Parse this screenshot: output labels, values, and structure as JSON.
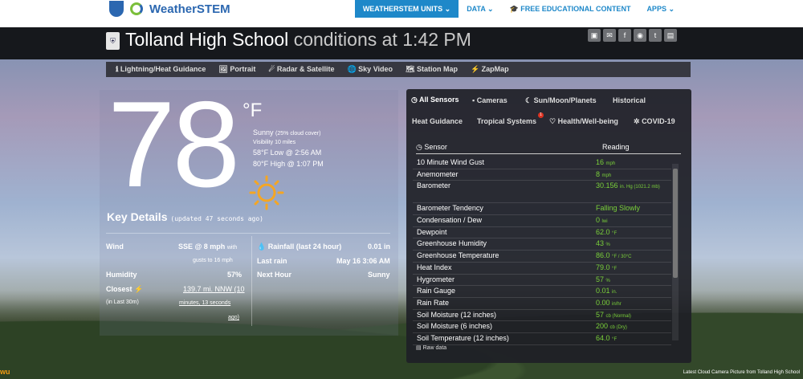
{
  "nav": {
    "logo_text": "WeatherSTEM",
    "items": [
      {
        "label": "WEATHERSTEM UNITS ⌄",
        "active": true
      },
      {
        "label": "DATA ⌄",
        "active": false
      },
      {
        "label": "🎓 FREE EDUCATIONAL CONTENT",
        "active": false
      },
      {
        "label": "APPS ⌄",
        "active": false
      }
    ]
  },
  "title": {
    "school": "Tolland High School",
    "conditions": "conditions at 1:42 PM"
  },
  "social_icons": [
    "calendar-icon",
    "mail-icon",
    "facebook-icon",
    "chat-icon",
    "twitter-icon",
    "tv-icon"
  ],
  "subnav": [
    "ℹ Lightning/Heat Guidance",
    "🖼 Portrait",
    "☄ Radar & Satellite",
    "🌐 Sky Video",
    "🗺 Station Map",
    "⚡ ZapMap"
  ],
  "current": {
    "temp": "78",
    "unit": "°F",
    "condition": "Sunny",
    "cloud_cover": "(25% cloud cover)",
    "visibility": "Visibility 10 miles",
    "low": "58°F Low @ 2:56 AM",
    "high": "80°F High @ 1:07 PM"
  },
  "key_details": {
    "heading": "Key Details",
    "updated": "(updated 47 seconds ago)",
    "wind_label": "Wind",
    "wind_value": "SSE @ 8 mph",
    "wind_with": "with",
    "gusts": "gusts to 16 mph",
    "humidity_label": "Humidity",
    "humidity_value": "57%",
    "closest_label": "Closest ⚡",
    "closest_note": "(in Last 30m)",
    "closest_value": "139.7 mi. NNW (10",
    "closest_value2": "minutes, 13 seconds",
    "closest_value3": "ago)",
    "rain_label": "Rainfall (last 24 hour)",
    "rain_value": "0.01 in",
    "lastrain_label": "Last rain",
    "lastrain_value": "May 16 3:06 AM",
    "nexthour_label": "Next Hour",
    "nexthour_value": "Sunny"
  },
  "tabs": {
    "all_sensors": "All Sensors",
    "cameras": "Cameras",
    "sun_moon": "Sun/Moon/Planets",
    "historical": "Historical",
    "heat_guidance": "Heat Guidance",
    "tropical": "Tropical Systems",
    "tropical_badge": "1",
    "health": "Health/Well-being",
    "covid": "COVID-19"
  },
  "sensor_table": {
    "col_sensor": "Sensor",
    "col_reading": "Reading",
    "rows": [
      {
        "name": "10 Minute Wind Gust",
        "value": "16",
        "unit": "mph"
      },
      {
        "name": "Anemometer",
        "value": "8",
        "unit": "mph"
      },
      {
        "name": "Barometer",
        "value": "30.156",
        "unit": "in. Hg (1021.2 mb)"
      },
      {
        "name": "Barometer Tendency",
        "value": "Falling Slowly",
        "unit": ""
      },
      {
        "name": "Condensation / Dew",
        "value": "0",
        "unit": "lwi"
      },
      {
        "name": "Dewpoint",
        "value": "62.0",
        "unit": "°F"
      },
      {
        "name": "Greenhouse Humidity",
        "value": "43",
        "unit": "%"
      },
      {
        "name": "Greenhouse Temperature",
        "value": "86.0",
        "unit": "°F / 30°C"
      },
      {
        "name": "Heat Index",
        "value": "79.0",
        "unit": "°F"
      },
      {
        "name": "Hygrometer",
        "value": "57",
        "unit": "%"
      },
      {
        "name": "Rain Gauge",
        "value": "0.01",
        "unit": "in."
      },
      {
        "name": "Rain Rate",
        "value": "0.00",
        "unit": "in/hr"
      },
      {
        "name": "Soil Moisture (12 inches)",
        "value": "57",
        "unit": "cb (Normal)"
      },
      {
        "name": "Soil Moisture (6 inches)",
        "value": "200",
        "unit": "cb (Dry)"
      },
      {
        "name": "Soil Temperature (12 inches)",
        "value": "64.0",
        "unit": "°F"
      }
    ],
    "raw_data": "Raw data"
  },
  "caption": "Latest Cloud Camera Picture from Tolland High School",
  "wu_logo": "wu"
}
